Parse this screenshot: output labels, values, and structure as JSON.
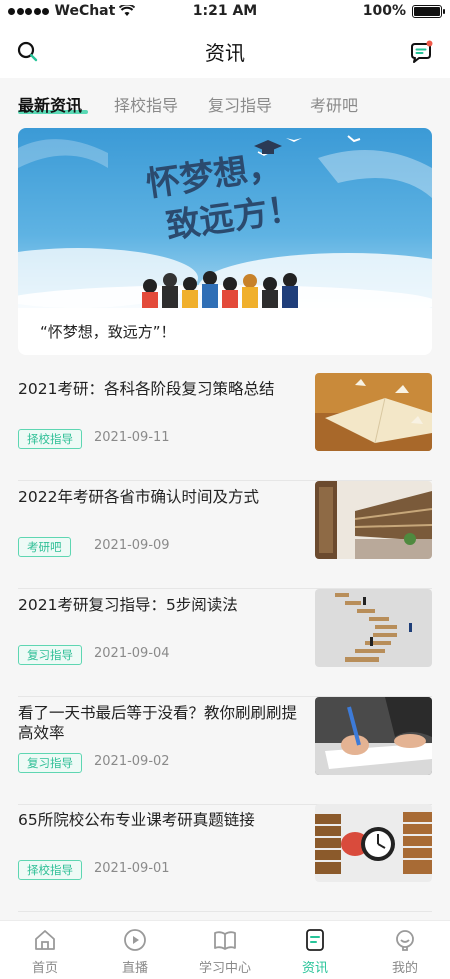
{
  "status_bar": {
    "carrier": "WeChat",
    "time": "1:21 AM",
    "battery_text": "100%"
  },
  "header": {
    "title": "资讯"
  },
  "tabs": [
    {
      "label": "最新资讯",
      "active": true
    },
    {
      "label": "择校指导",
      "active": false
    },
    {
      "label": "复习指导",
      "active": false
    },
    {
      "label": "考研吧",
      "active": false
    }
  ],
  "banner": {
    "headline_line1": "怀梦想，",
    "headline_line2": "致远方！",
    "caption": "“怀梦想，致远方”！"
  },
  "articles": [
    {
      "title": "2021考研：各科各阶段复习策略总结",
      "tag": "择校指导",
      "date": "2021-09-11",
      "thumb": "open-book-paper-cranes"
    },
    {
      "title": "2022年考研各省市确认时间及方式",
      "tag": "考研吧",
      "date": "2021-09-09",
      "thumb": "library-shelves"
    },
    {
      "title": "2021考研复习指导：5步阅读法",
      "tag": "复习指导",
      "date": "2021-09-04",
      "thumb": "book-staircase"
    },
    {
      "title": "看了一天书最后等于没看？教你刷刷刷提高效率",
      "tag": "复习指导",
      "date": "2021-09-02",
      "thumb": "writing-hand"
    },
    {
      "title": "65所院校公布专业课考研真题链接",
      "tag": "择校指导",
      "date": "2021-09-01",
      "thumb": "alarm-clock-books"
    }
  ],
  "tabbar": [
    {
      "label": "首页",
      "icon": "home-icon",
      "active": false
    },
    {
      "label": "直播",
      "icon": "play-icon",
      "active": false
    },
    {
      "label": "学习中心",
      "icon": "book-icon",
      "active": false
    },
    {
      "label": "资讯",
      "icon": "news-icon",
      "active": true
    },
    {
      "label": "我的",
      "icon": "profile-icon",
      "active": false
    }
  ],
  "colors": {
    "accent": "#27c499",
    "tag_border": "#5ed6b2",
    "background": "#f6f6f6",
    "notification_dot": "#f05a4a"
  }
}
